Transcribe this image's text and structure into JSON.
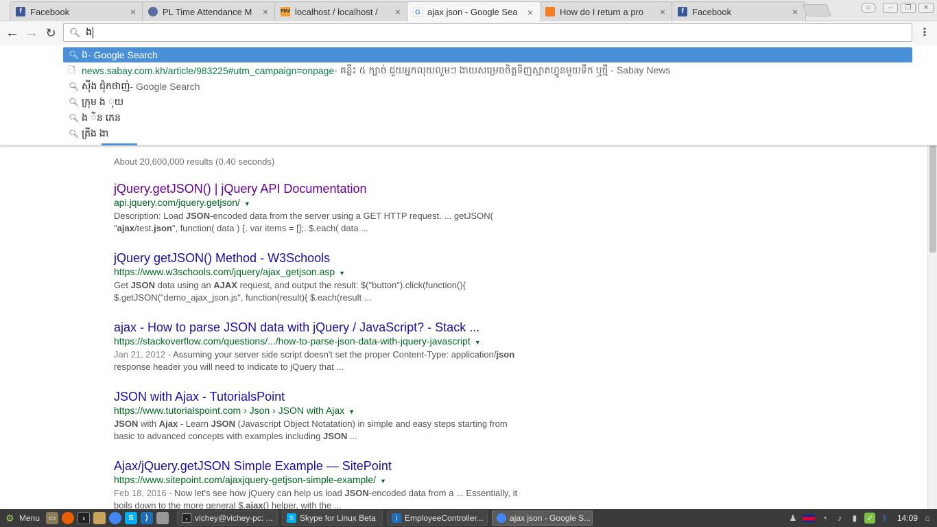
{
  "browser": {
    "tabs": [
      {
        "title": "Facebook",
        "icon": "facebook-icon",
        "active": false
      },
      {
        "title": "PL Time Attendance M",
        "icon": "pl-logo-icon",
        "active": false
      },
      {
        "title": "localhost / localhost / ",
        "icon": "phpmyadmin-icon",
        "active": false
      },
      {
        "title": "ajax json - Google Sea",
        "icon": "google-icon",
        "active": true
      },
      {
        "title": "How do I return a pro",
        "icon": "stackoverflow-icon",
        "active": false
      },
      {
        "title": "Facebook",
        "icon": "facebook-icon",
        "active": false
      }
    ],
    "close_glyph": "×",
    "address": {
      "value": "ង"
    },
    "suggestions": [
      {
        "icon": "search-icon",
        "text": "ង",
        "desc": " - Google Search",
        "selected": true
      },
      {
        "icon": "page-icon",
        "url": "news.sabay.com.kh/article/983225#utm_campaign=onpage",
        "desc": " - គន្លឹះ ៥ ក្បាច់ ជួយអ្នកលុយលួមៗ ងាយសម្រេចចិត្តទិញស្មាតហ្វូនមួយទឹក ឬថ្មី - Sabay News",
        "selected": false
      },
      {
        "icon": "search-icon",
        "text": "ស៊ីង ជុំកថាញ់",
        "desc": " - Google Search",
        "selected": false
      },
      {
        "icon": "search-icon",
        "text": "ក្រុម ង ុយ",
        "desc": "",
        "selected": false
      },
      {
        "icon": "search-icon",
        "text": "ង ិន ភេន",
        "desc": "",
        "selected": false
      },
      {
        "icon": "search-icon",
        "text": "ត្រីង ងា",
        "desc": "",
        "selected": false
      }
    ]
  },
  "page": {
    "stats": "About 20,600,000 results (0.40 seconds)",
    "results": [
      {
        "title": "jQuery.getJSON() | jQuery API Documentation",
        "visited": true,
        "url": "api.jquery.com/jquery.getjson/",
        "date": "",
        "snippet": [
          {
            "t": "Description: Load "
          },
          {
            "t": "JSON",
            "b": true
          },
          {
            "t": "-encoded data from the server using a GET HTTP request. ... getJSON( \""
          },
          {
            "t": "ajax",
            "b": true
          },
          {
            "t": "/test."
          },
          {
            "t": "json",
            "b": true
          },
          {
            "t": "\", function( data ) {. var items = [];. $.each( data ..."
          }
        ]
      },
      {
        "title": "jQuery getJSON() Method - W3Schools",
        "visited": false,
        "url": "https://www.w3schools.com/jquery/ajax_getjson.asp",
        "date": "",
        "snippet": [
          {
            "t": "Get "
          },
          {
            "t": "JSON",
            "b": true
          },
          {
            "t": " data using an "
          },
          {
            "t": "AJAX",
            "b": true
          },
          {
            "t": " request, and output the result: $(\"button\").click(function(){ $.getJSON(\"demo_ajax_json.js\", function(result){ $.each(result ..."
          }
        ]
      },
      {
        "title": "ajax - How to parse JSON data with jQuery / JavaScript? - Stack ...",
        "visited": false,
        "url": "https://stackoverflow.com/questions/.../how-to-parse-json-data-with-jquery-javascript",
        "date": "Jan 21, 2012 - ",
        "snippet": [
          {
            "t": "Assuming your server side script doesn't set the proper Content-Type: application/"
          },
          {
            "t": "json",
            "b": true
          },
          {
            "t": " response header you will need to indicate to jQuery that ..."
          }
        ]
      },
      {
        "title": "JSON with Ajax - TutorialsPoint",
        "visited": false,
        "url": "https://www.tutorialspoint.com › Json › JSON with Ajax",
        "date": "",
        "snippet": [
          {
            "t": "JSON",
            "b": true
          },
          {
            "t": " with "
          },
          {
            "t": "Ajax",
            "b": true
          },
          {
            "t": " - Learn "
          },
          {
            "t": "JSON",
            "b": true
          },
          {
            "t": " (Javascript Object Notatation) in simple and easy steps starting from basic to advanced concepts with examples including "
          },
          {
            "t": "JSON",
            "b": true
          },
          {
            "t": " ..."
          }
        ]
      },
      {
        "title": "Ajax/jQuery.getJSON Simple Example — SitePoint",
        "visited": false,
        "url": "https://www.sitepoint.com/ajaxjquery-getjson-simple-example/",
        "date": "Feb 18, 2016 - ",
        "snippet": [
          {
            "t": "Now let's see how jQuery can help us load "
          },
          {
            "t": "JSON",
            "b": true
          },
          {
            "t": "-encoded data from a ... Essentially, it boils down to the more general $."
          },
          {
            "t": "ajax",
            "b": true
          },
          {
            "t": "() helper, with the ..."
          }
        ]
      }
    ]
  },
  "taskbar": {
    "menu_label": "Menu",
    "tasks": [
      {
        "label": "vichey@vichey-pc: ...",
        "icon": "terminal-icon",
        "active": false
      },
      {
        "label": "Skype for Linux Beta",
        "icon": "skype-icon",
        "active": false
      },
      {
        "label": "EmployeeController...",
        "icon": "vscode-icon",
        "active": false
      },
      {
        "label": "ajax json - Google S...",
        "icon": "chrome-icon",
        "active": true
      }
    ],
    "clock": "14:09"
  },
  "colors": {
    "link": "#1a0dab",
    "visited": "#660099",
    "url_green": "#006621",
    "selection": "#4a90d9"
  }
}
